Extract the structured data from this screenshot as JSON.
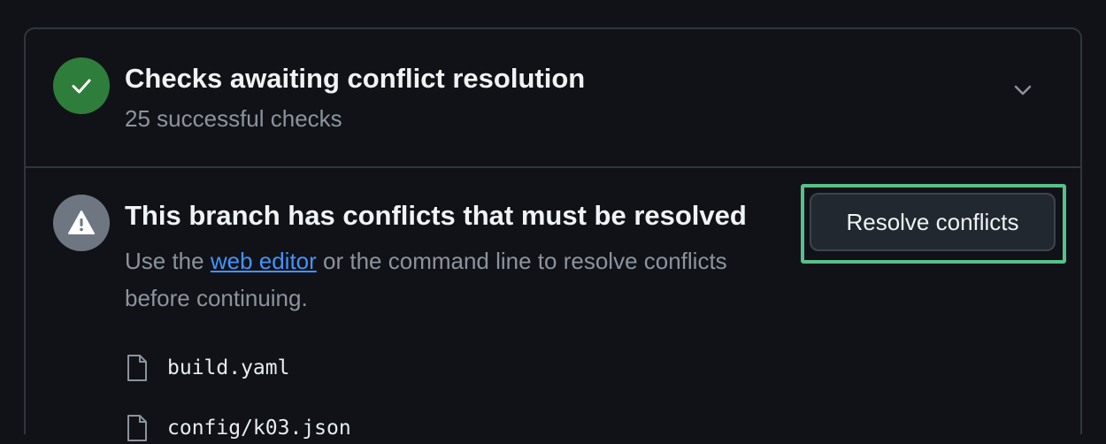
{
  "checks": {
    "title": "Checks awaiting conflict resolution",
    "subtitle": "25 successful checks",
    "status_icon": "check-icon",
    "status_color": "#2f7d3b",
    "expand_icon": "chevron-down-icon"
  },
  "conflicts": {
    "title": "This branch has conflicts that must be resolved",
    "desc_before": "Use the ",
    "desc_link": "web editor",
    "desc_after": " or the command line to resolve conflicts before continuing.",
    "status_icon": "alert-icon",
    "resolve_button": "Resolve conflicts",
    "files": [
      {
        "name": "build.yaml",
        "icon": "file-icon"
      },
      {
        "name": "config/k03.json",
        "icon": "file-icon"
      }
    ]
  },
  "colors": {
    "background": "#111217",
    "link": "#4493f8",
    "highlight": "#58c08a"
  }
}
